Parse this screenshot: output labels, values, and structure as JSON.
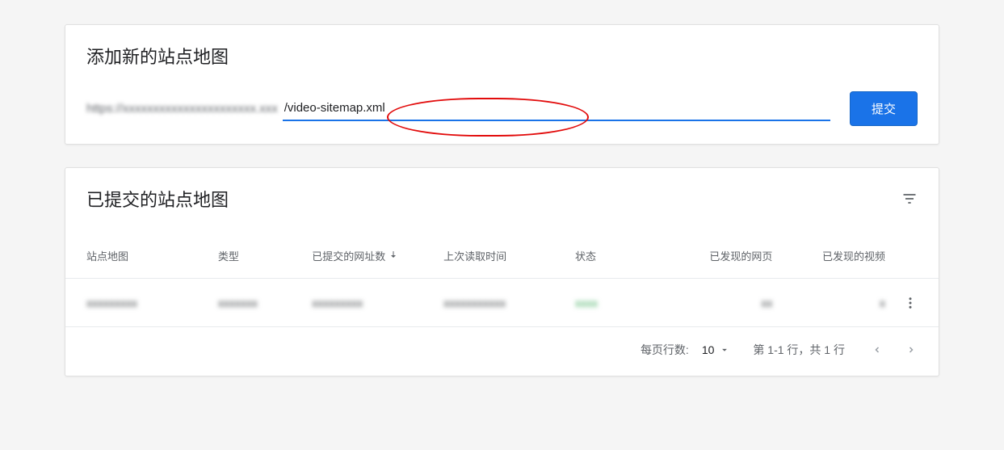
{
  "add_section": {
    "title": "添加新的站点地图",
    "url_prefix": "https://xxxxxxxxxxxxxxxxxxxxxx.xxx",
    "input_value": "/video-sitemap.xml",
    "submit_label": "提交"
  },
  "submitted_section": {
    "title": "已提交的站点地图",
    "columns": {
      "sitemap": "站点地图",
      "type": "类型",
      "submitted_count": "已提交的网址数",
      "last_read": "上次读取时间",
      "status": "状态",
      "pages_found": "已发现的网页",
      "videos_found": "已发现的视频"
    },
    "rows": [
      {
        "sitemap": "xxxxxxxxx",
        "type": "xxxxxxx",
        "submitted_count": "xxxxxxxxx",
        "last_read": "xxxxxxxxxxx",
        "status": "xxxx",
        "pages_found": "xx",
        "videos_found": "x"
      }
    ],
    "pagination": {
      "rows_per_page_label": "每页行数:",
      "rows_per_page_value": "10",
      "range_info": "第 1-1 行，共 1 行"
    }
  }
}
